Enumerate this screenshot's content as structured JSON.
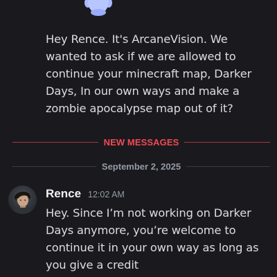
{
  "previous_message": {
    "text": "Hey Rence. It's ArcaneVision. We wanted to ask if we are allowed to continue your minecraft map, Darker Days, In our own ways and make a zombie apocalypse map out of it?"
  },
  "new_messages_divider": {
    "label": "NEW MESSAGES",
    "color": "#f04a55"
  },
  "date_divider": {
    "label": "September 2, 2025"
  },
  "reply": {
    "author": "Rence",
    "timestamp": "12:02 AM",
    "text": "Hey. Since I’m not working on Darker Days anymore, you’re welcome to continue it in your own way as long as you give a credit"
  },
  "colors": {
    "background": "#1a1a1e",
    "discord_blurple": "#5865f2"
  }
}
